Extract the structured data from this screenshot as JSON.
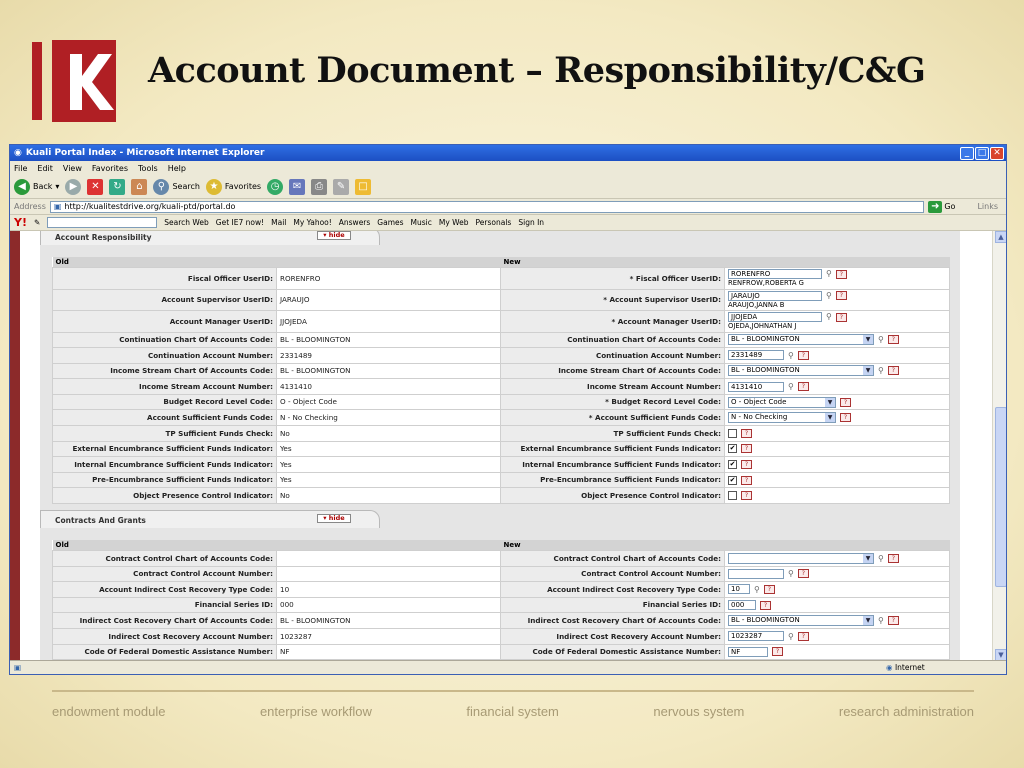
{
  "slide": {
    "title": "Account Document – Responsibility/C&G",
    "footer_items": [
      "endowment module",
      "enterprise workflow",
      "financial system",
      "nervous system",
      "research administration"
    ]
  },
  "window": {
    "title": "Kuali Portal Index - Microsoft Internet Explorer"
  },
  "menu": [
    "File",
    "Edit",
    "View",
    "Favorites",
    "Tools",
    "Help"
  ],
  "toolbar": {
    "back": "Back",
    "search": "Search",
    "favorites": "Favorites"
  },
  "address": {
    "label": "Address",
    "url": "http://kualitestdrive.org/kuali-ptd/portal.do",
    "go": "Go",
    "links": "Links"
  },
  "yahoo": {
    "search_web": "Search Web",
    "get_ie7": "Get IE7 now!",
    "mail": "Mail",
    "my_yahoo": "My Yahoo!",
    "answers": "Answers",
    "games": "Games",
    "music": "Music",
    "my_web": "My Web",
    "personals": "Personals",
    "sign_in": "Sign In"
  },
  "account_responsibility": {
    "tab_title": "Account Responsibility",
    "hide": "▾ hide",
    "col_old": "Old",
    "col_new": "New",
    "rows": [
      {
        "label": "Fiscal Officer UserID:",
        "old": "RORENFRO",
        "new_label": "*  Fiscal Officer UserID:",
        "new_value": "RORENFRO",
        "new_sub": "RENFROW,ROBERTA G"
      },
      {
        "label": "Account Supervisor UserID:",
        "old": "JARAUJO",
        "new_label": "*  Account Supervisor UserID:",
        "new_value": "JARAUJO",
        "new_sub": "ARAUJO,JANNA B"
      },
      {
        "label": "Account Manager UserID:",
        "old": "JJOJEDA",
        "new_label": "*  Account Manager UserID:",
        "new_value": "JJOJEDA",
        "new_sub": "OJEDA,JOHNATHAN J"
      },
      {
        "label": "Continuation Chart Of Accounts Code:",
        "old": "BL - BLOOMINGTON",
        "new_label": "Continuation Chart Of Accounts Code:",
        "new_value": "BL - BLOOMINGTON"
      },
      {
        "label": "Continuation Account Number:",
        "old": "2331489",
        "new_label": "Continuation Account Number:",
        "new_value": "2331489"
      },
      {
        "label": "Income Stream Chart Of Accounts Code:",
        "old": "BL - BLOOMINGTON",
        "new_label": "Income Stream Chart Of Accounts Code:",
        "new_value": "BL - BLOOMINGTON"
      },
      {
        "label": "Income Stream Account Number:",
        "old": "4131410",
        "new_label": "Income Stream Account Number:",
        "new_value": "4131410"
      },
      {
        "label": "Budget Record Level Code:",
        "old": "O - Object Code",
        "new_label": "*  Budget Record Level Code:",
        "new_value": "O - Object Code"
      },
      {
        "label": "Account Sufficient Funds Code:",
        "old": "N - No Checking",
        "new_label": "*  Account Sufficient Funds Code:",
        "new_value": "N - No Checking"
      },
      {
        "label": "TP Sufficient Funds Check:",
        "old": "No",
        "new_label": "TP Sufficient Funds Check:",
        "new_value": ""
      },
      {
        "label": "External Encumbrance Sufficient Funds Indicator:",
        "old": "Yes",
        "new_label": "External Encumbrance Sufficient Funds Indicator:",
        "new_value": "✔"
      },
      {
        "label": "Internal Encumbrance Sufficient Funds Indicator:",
        "old": "Yes",
        "new_label": "Internal Encumbrance Sufficient Funds Indicator:",
        "new_value": "✔"
      },
      {
        "label": "Pre-Encumbrance Sufficient Funds Indicator:",
        "old": "Yes",
        "new_label": "Pre-Encumbrance Sufficient Funds Indicator:",
        "new_value": "✔"
      },
      {
        "label": "Object Presence Control Indicator:",
        "old": "No",
        "new_label": "Object Presence Control Indicator:",
        "new_value": ""
      }
    ]
  },
  "contracts_grants": {
    "tab_title": "Contracts And Grants",
    "hide": "▾ hide",
    "col_old": "Old",
    "col_new": "New",
    "rows": [
      {
        "label": "Contract Control Chart of Accounts Code:",
        "old": "",
        "new_label": "Contract Control Chart of Accounts Code:",
        "new_value": ""
      },
      {
        "label": "Contract Control Account Number:",
        "old": "",
        "new_label": "Contract Control Account Number:",
        "new_value": ""
      },
      {
        "label": "Account Indirect Cost Recovery Type Code:",
        "old": "10",
        "new_label": "Account Indirect Cost Recovery Type Code:",
        "new_value": "10"
      },
      {
        "label": "Financial Series ID:",
        "old": "000",
        "new_label": "Financial Series ID:",
        "new_value": "000"
      },
      {
        "label": "Indirect Cost Recovery Chart Of Accounts Code:",
        "old": "BL - BLOOMINGTON",
        "new_label": "Indirect Cost Recovery Chart Of Accounts Code:",
        "new_value": "BL - BLOOMINGTON"
      },
      {
        "label": "Indirect Cost Recovery Account Number:",
        "old": "1023287",
        "new_label": "Indirect Cost Recovery Account Number:",
        "new_value": "1023287"
      },
      {
        "label": "Code Of Federal Domestic Assistance Number:",
        "old": "NF",
        "new_label": "Code Of Federal Domestic Assistance Number:",
        "new_value": "NF"
      }
    ]
  },
  "status": {
    "zone": "Internet"
  },
  "colors": {
    "accent": "#8c2a2a",
    "titlebar": "#1c4fc3"
  }
}
